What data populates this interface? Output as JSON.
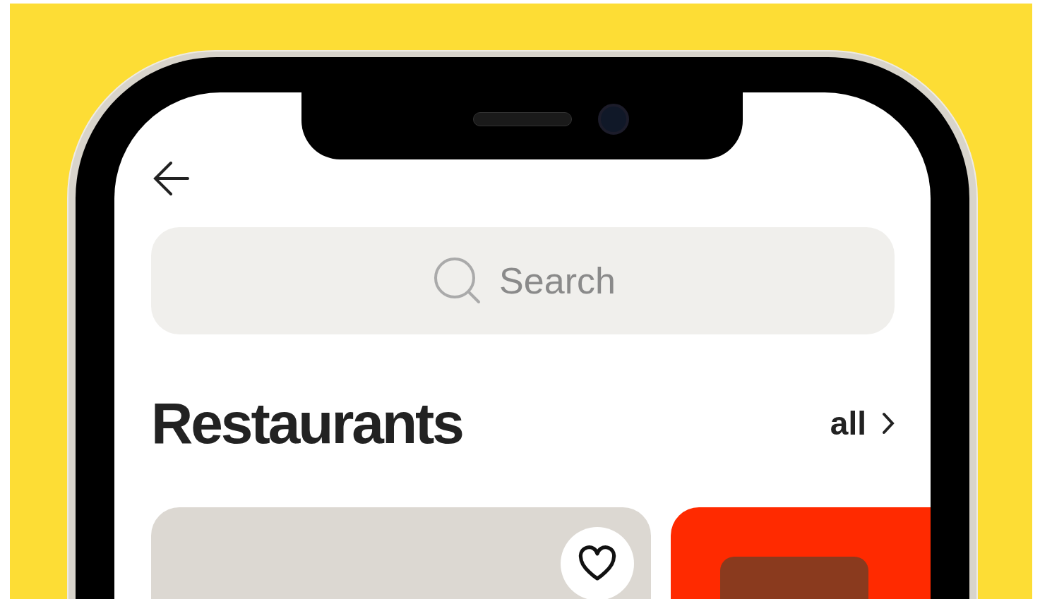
{
  "search": {
    "placeholder": "Search"
  },
  "section": {
    "title": "Restaurants",
    "link": "all"
  },
  "cards": [
    {
      "kind": "favorable",
      "favorite": false
    },
    {
      "kind": "plain"
    }
  ]
}
